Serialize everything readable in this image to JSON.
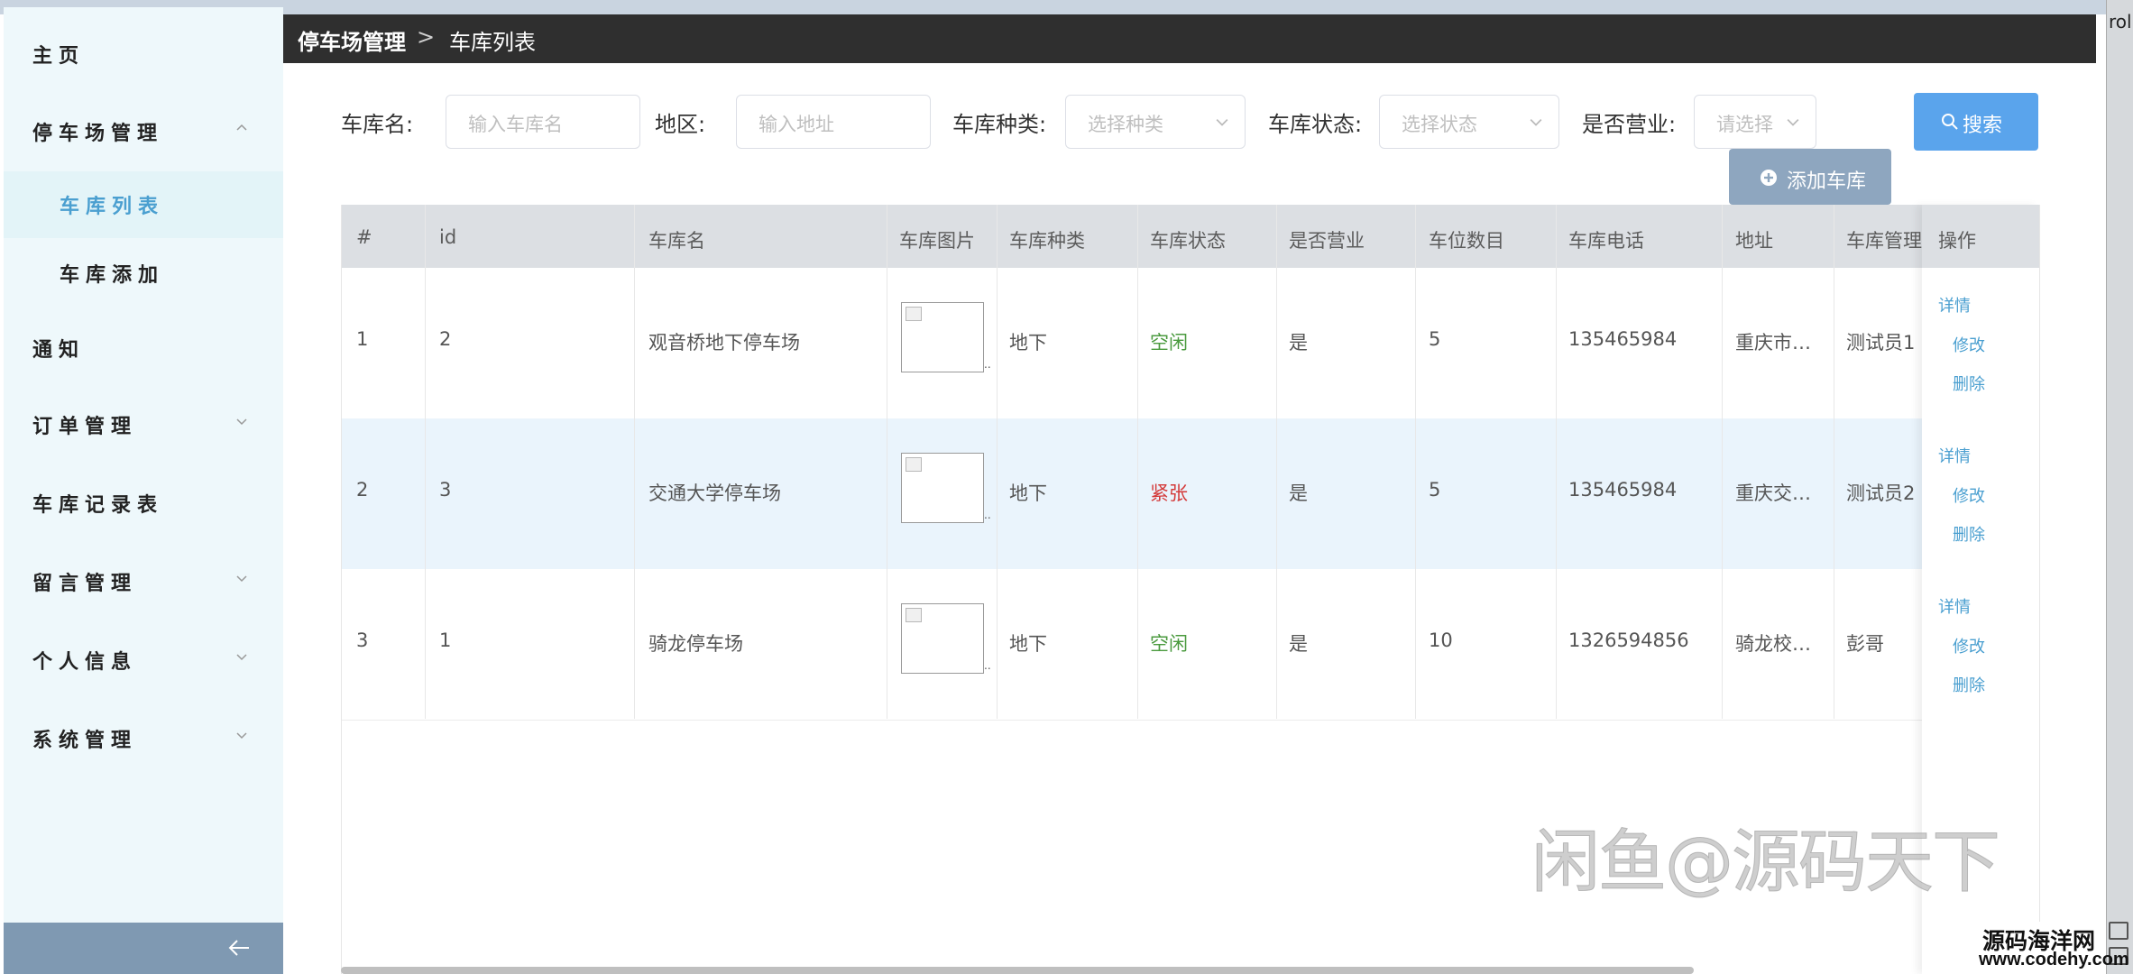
{
  "sidebar": {
    "items": [
      {
        "label": "主页",
        "chevron": "none"
      },
      {
        "label": "停车场管理",
        "chevron": "up"
      },
      {
        "label": "订单管理",
        "chevron": "down"
      },
      {
        "label": "车库记录表",
        "chevron": "none"
      },
      {
        "label": "留言管理",
        "chevron": "down"
      },
      {
        "label": "个人信息",
        "chevron": "down"
      },
      {
        "label": "系统管理",
        "chevron": "down"
      },
      {
        "label": "通知",
        "chevron": "none"
      }
    ],
    "submenu": [
      {
        "label": "车库列表",
        "active": true
      },
      {
        "label": "车库添加",
        "active": false
      }
    ],
    "collapse_icon": "arrow-left-icon",
    "active_color": "#4a9fd0",
    "background_color": "#eef8fb"
  },
  "header": {
    "breadcrumb": [
      "停车场管理",
      "车库列表"
    ],
    "separator": ">"
  },
  "filters": {
    "name": {
      "label": "车库名:",
      "placeholder": "输入车库名"
    },
    "region": {
      "label": "地区:",
      "placeholder": "输入地址"
    },
    "type": {
      "label": "车库种类:",
      "placeholder": "选择种类"
    },
    "status": {
      "label": "车库状态:",
      "placeholder": "选择状态"
    },
    "open": {
      "label": "是否营业:",
      "placeholder": "请选择"
    },
    "search_label": "搜索",
    "add_label": "添加车库"
  },
  "table": {
    "columns": [
      "#",
      "id",
      "车库名",
      "车库图片",
      "车库种类",
      "车库状态",
      "是否营业",
      "车位数目",
      "车库电话",
      "地址",
      "车库管理",
      "操作"
    ],
    "rows": [
      {
        "index": "1",
        "id": "2",
        "name": "观音桥地下停车场",
        "type": "地下",
        "status": "空闲",
        "open": "是",
        "spaces": "5",
        "phone": "135465984",
        "address": "重庆市…",
        "manager": "测试员1"
      },
      {
        "index": "2",
        "id": "3",
        "name": "交通大学停车场",
        "type": "地下",
        "status": "紧张",
        "open": "是",
        "spaces": "5",
        "phone": "135465984",
        "address": "重庆交…",
        "manager": "测试员2"
      },
      {
        "index": "3",
        "id": "1",
        "name": "骑龙停车场",
        "type": "地下",
        "status": "空闲",
        "open": "是",
        "spaces": "10",
        "phone": "1326594856",
        "address": "骑龙校…",
        "manager": "彭哥"
      }
    ],
    "actions": [
      "详情",
      "修改",
      "删除"
    ]
  },
  "overlay": {
    "watermark": "闲鱼@源码天下",
    "site_name": "源码海洋网",
    "site_url": "www.codehy.com",
    "right_edge_text": "rol"
  },
  "colors": {
    "header_bg": "#2f2f2f",
    "primary": "#5aa4ec",
    "add_button": "#8ea6bf",
    "status_free": "#4a9a3e",
    "status_busy": "#d43a3a"
  }
}
